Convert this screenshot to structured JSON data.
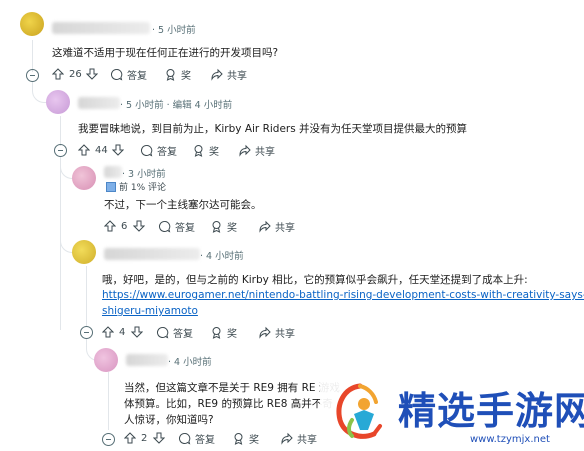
{
  "actions": {
    "reply": "答复",
    "award": "奖",
    "share": "共享"
  },
  "comments": [
    {
      "meta": "· 5 小时前",
      "lines": [
        "这难道不适用于现在任何正在进行的开发项目吗?"
      ],
      "votes": "26"
    },
    {
      "meta": "· 5 小时前 · 编辑 4 小时前",
      "lines": [
        "我要冒昧地说，到目前为止，Kirby Air Riders 并没有为任天堂项目提供最大的预算"
      ],
      "votes": "44"
    },
    {
      "meta": "· 3 小时前",
      "flair": "前 1% 评论",
      "lines": [
        "不过，下一个主线塞尔达可能会。"
      ],
      "votes": "6"
    },
    {
      "meta": "· 4 小时前",
      "lines": [
        "哦，好吧，是的，但与之前的 Kirby 相比，它的预算似乎会飙升，任天堂还提到了成本上升:"
      ],
      "link_lines": [
        "https://www.eurogamer.net/nintendo-battling-rising-development-costs-with-creativity-says-",
        "shigeru-miyamoto"
      ],
      "votes": "4"
    },
    {
      "meta": "· 4 小时前",
      "lines": [
        "当然，但这篇文章不是关于 RE9 拥有 RE 游戏",
        "体预算。比如，RE9 的预算比 RE8 高并不奇",
        "人惊讶，你知道吗?"
      ],
      "votes": "2"
    }
  ],
  "watermark": {
    "title": "精选手游网",
    "url": "www.tzymjx.net"
  },
  "colors": {
    "link": "#0a63c5",
    "meta": "#576f76",
    "thread": "#e2e6ea",
    "watermark_blue": "#1f4fb8"
  }
}
